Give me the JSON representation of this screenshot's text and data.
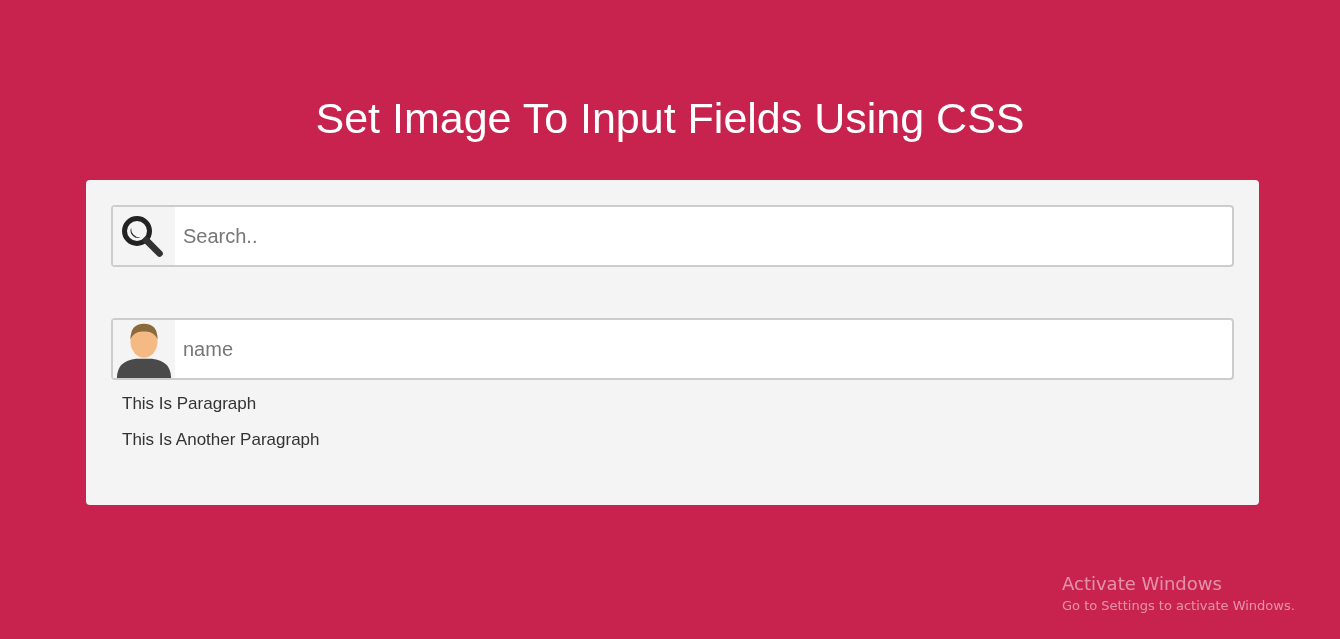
{
  "title": "Set Image To Input Fields Using CSS",
  "fields": [
    {
      "kind": "search",
      "placeholder": "Search.."
    },
    {
      "kind": "person",
      "placeholder": "name"
    }
  ],
  "paragraphs": [
    "This Is Paragraph",
    "This Is Another Paragraph"
  ],
  "activation_notice": {
    "title": "Activate Windows",
    "message": "Go to Settings to activate Windows."
  }
}
